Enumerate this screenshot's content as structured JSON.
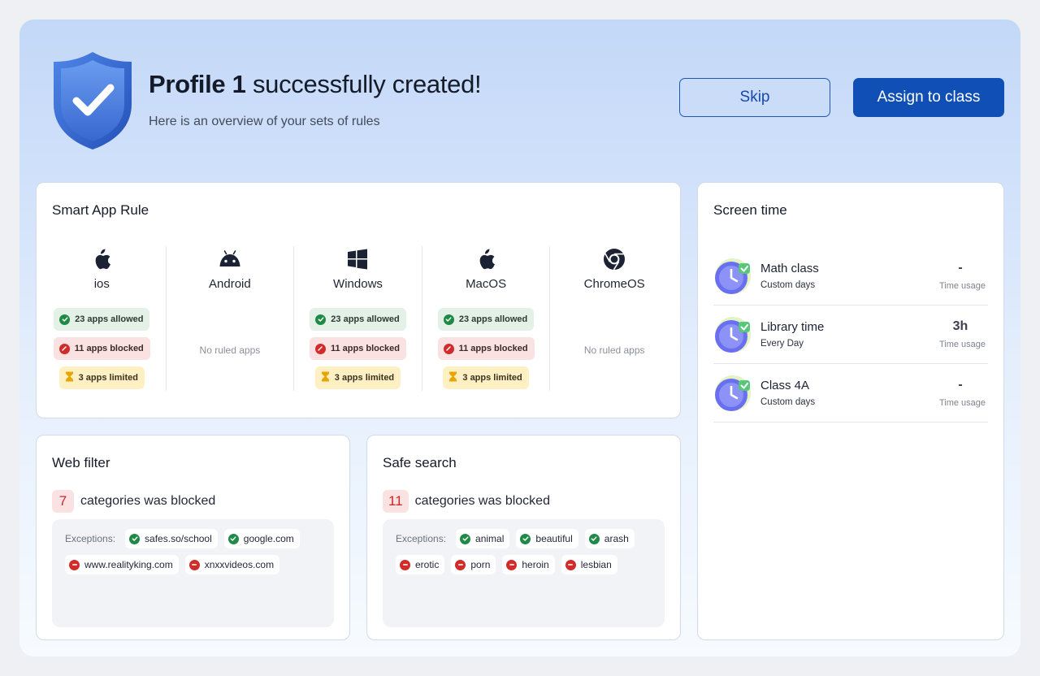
{
  "header": {
    "title_bold": "Profile 1",
    "title_rest": " successfully created!",
    "subtitle": "Here is an overview of your sets of rules",
    "skip_label": "Skip",
    "assign_label": "Assign to class"
  },
  "smart_app_rule": {
    "title": "Smart App Rule",
    "platforms": [
      {
        "name": "ios",
        "icon": "apple-icon",
        "allowed": "23 apps allowed",
        "blocked": "11 apps blocked",
        "limited": "3 apps limited"
      },
      {
        "name": "Android",
        "icon": "android-icon",
        "empty": "No ruled apps"
      },
      {
        "name": "Windows",
        "icon": "windows-icon",
        "allowed": "23 apps allowed",
        "blocked": "11 apps blocked",
        "limited": "3 apps limited"
      },
      {
        "name": "MacOS",
        "icon": "apple-icon",
        "allowed": "23 apps allowed",
        "blocked": "11 apps blocked",
        "limited": "3 apps limited"
      },
      {
        "name": "ChromeOS",
        "icon": "chrome-icon",
        "empty": "No ruled apps"
      }
    ]
  },
  "web_filter": {
    "title": "Web filter",
    "count": "7",
    "count_text": "categories was blocked",
    "exceptions_label": "Exceptions:",
    "allowed": [
      "safes.so/school",
      "google.com"
    ],
    "blocked": [
      "www.realityking.com",
      "xnxxvideos.com"
    ]
  },
  "safe_search": {
    "title": "Safe search",
    "count": "11",
    "count_text": "categories was blocked",
    "exceptions_label": "Exceptions:",
    "allowed": [
      "animal",
      "beautiful",
      "arash"
    ],
    "blocked": [
      "erotic",
      "porn",
      "heroin",
      "lesbian"
    ]
  },
  "screen_time": {
    "title": "Screen time",
    "items": [
      {
        "name": "Math class",
        "days": "Custom days",
        "value": "-",
        "usage_label": "Time usage"
      },
      {
        "name": "Library time",
        "days": "Every Day",
        "value": "3h",
        "usage_label": "Time usage"
      },
      {
        "name": "Class 4A",
        "days": "Custom days",
        "value": "-",
        "usage_label": "Time usage"
      }
    ]
  },
  "colors": {
    "primary": "#0f4fb6",
    "allowed": "#1f8a46",
    "blocked": "#cf2c2c",
    "limited": "#e8a400"
  }
}
